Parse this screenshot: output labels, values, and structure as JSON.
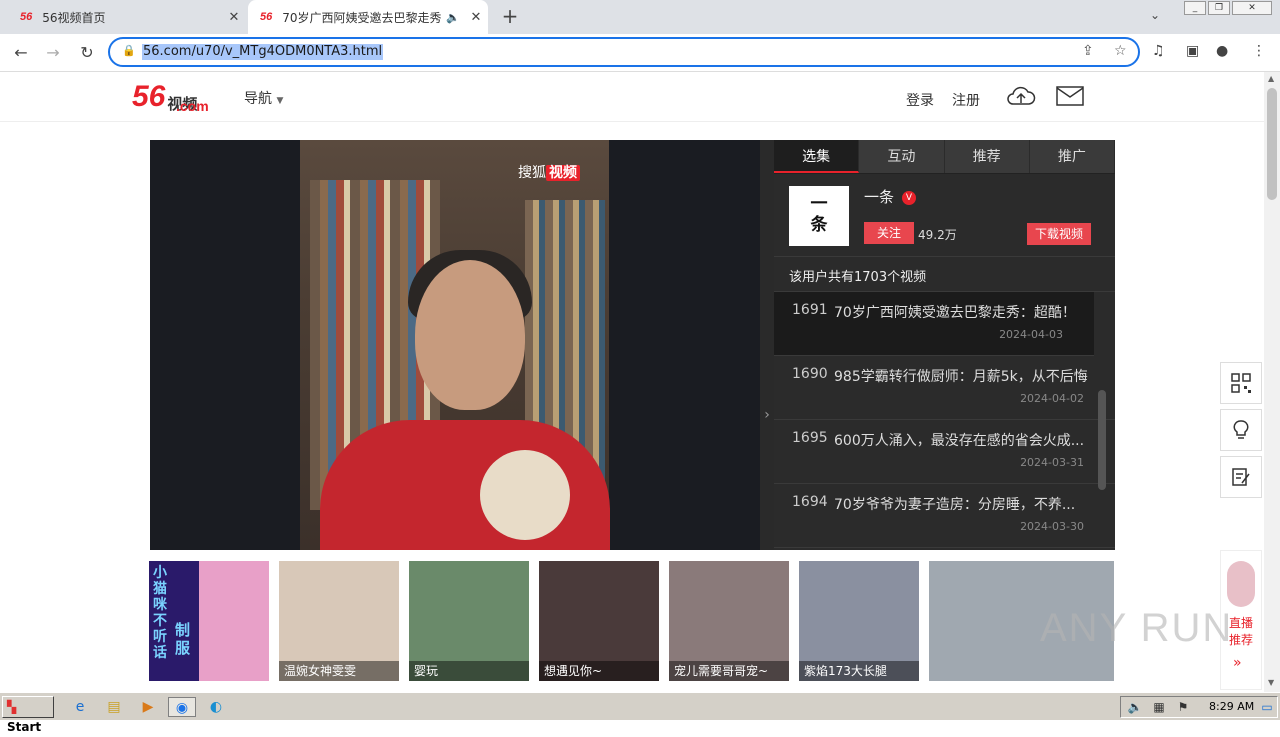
{
  "browser": {
    "tabs": [
      {
        "favicon": "56",
        "title": "56视频首页",
        "active": false
      },
      {
        "favicon": "56",
        "title": "70岁广西阿姨受邀去巴黎走秀",
        "active": true
      }
    ],
    "url": "56.com/u70/v_MTg4ODM0NTA3.html",
    "window_buttons": [
      "_",
      "❐",
      "✕"
    ]
  },
  "site": {
    "logo_num": "56",
    "logo_cn": "视频",
    "logo_com": ".com",
    "nav_label": "导航",
    "login": "登录",
    "register": "注册"
  },
  "player": {
    "watermark_a": "搜狐",
    "watermark_b": "视频"
  },
  "panel": {
    "tabs": [
      "选集",
      "互动",
      "推荐",
      "推广"
    ],
    "uploader": {
      "avatar_text_1": "一",
      "avatar_text_2": "条",
      "name": "一条",
      "badge": "V",
      "follow": "关注",
      "fans": "49.2万",
      "download": "下载视频"
    },
    "total_text": "该用户共有1703个视频",
    "videos": [
      {
        "num": "1691",
        "title": "70岁广西阿姨受邀去巴黎走秀：超酷！",
        "date": "2024-04-03"
      },
      {
        "num": "1690",
        "title": "985学霸转行做厨师：月薪5k，从不后悔",
        "date": "2024-04-02"
      },
      {
        "num": "1695",
        "title": "600万人涌入，最没存在感的省会火成...",
        "date": "2024-03-31"
      },
      {
        "num": "1694",
        "title": "70岁爷爷为妻子造房：分房睡，不养...",
        "date": "2024-03-30"
      }
    ]
  },
  "ads": {
    "cards": [
      {
        "caption": "",
        "color": "#3a2a7a"
      },
      {
        "caption": "温婉女神雯雯",
        "color": "#d8c8b8"
      },
      {
        "caption": "婴玩",
        "color": "#6a8a6a"
      },
      {
        "caption": "想遇见你~",
        "color": "#4a3a3a"
      },
      {
        "caption": "宠儿需要哥哥宠~",
        "color": "#8a7a7a"
      },
      {
        "caption": "紫焰173大长腿",
        "color": "#8a90a0"
      },
      {
        "caption": "",
        "color": "#a0a8b0"
      }
    ],
    "promo_text_left": "小猫咪不听话",
    "promo_text_right": "制服",
    "live_label": "直播推荐",
    "live_more": "»"
  },
  "watermark": "ANY RUN",
  "taskbar": {
    "start": "Start",
    "clock": "8:29 AM"
  }
}
